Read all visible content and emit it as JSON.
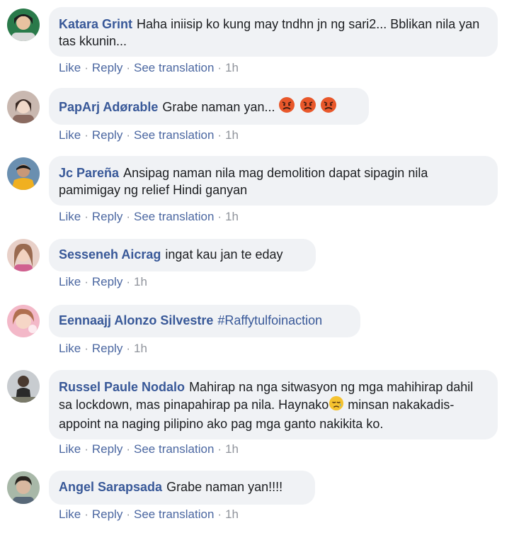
{
  "comments": [
    {
      "author": "Katara Grint",
      "text": "Haha iniisip ko kung may tndhn jn ng sari2... Bblikan nila yan tas kkunin...",
      "actions": {
        "like": "Like",
        "reply": "Reply",
        "translate": "See translation",
        "time": "1h"
      }
    },
    {
      "author": "PapArj Adørable",
      "text": "Grabe naman yan...",
      "emojis": [
        "angry-face-emoji",
        "angry-face-emoji",
        "angry-face-emoji"
      ],
      "actions": {
        "like": "Like",
        "reply": "Reply",
        "translate": "See translation",
        "time": "1h"
      }
    },
    {
      "author": "Jc Pareña",
      "text": "Ansipag naman nila mag demolition dapat sipagin nila pamimigay ng relief Hindi ganyan",
      "actions": {
        "like": "Like",
        "reply": "Reply",
        "translate": "See translation",
        "time": "1h"
      }
    },
    {
      "author": "Sesseneh Aicrag",
      "text": "ingat kau jan te eday",
      "actions": {
        "like": "Like",
        "reply": "Reply",
        "time": "1h"
      }
    },
    {
      "author": "Eennaajj Alonzo Silvestre",
      "hashtag": "#Raffytulfoinaction",
      "actions": {
        "like": "Like",
        "reply": "Reply",
        "time": "1h"
      }
    },
    {
      "author": "Russel Paule Nodalo",
      "text_before_emoji": "Mahirap na nga sitwasyon ng mga mahihirap dahil sa lockdown, mas pinapahirap pa nila. Haynako",
      "emoji": "disappointed-face-emoji",
      "text_after_emoji": " minsan nakakadis-appoint na naging pilipino ako pag mga ganto nakikita ko.",
      "actions": {
        "like": "Like",
        "reply": "Reply",
        "translate": "See translation",
        "time": "1h"
      }
    },
    {
      "author": "Angel Sarapsada",
      "text": "Grabe naman yan!!!!",
      "actions": {
        "like": "Like",
        "reply": "Reply",
        "translate": "See translation",
        "time": "1h"
      }
    }
  ],
  "colors": {
    "bubble_bg": "#f0f2f5",
    "author": "#385898",
    "action_link": "#4b67a1",
    "meta_gray": "#90949c"
  }
}
